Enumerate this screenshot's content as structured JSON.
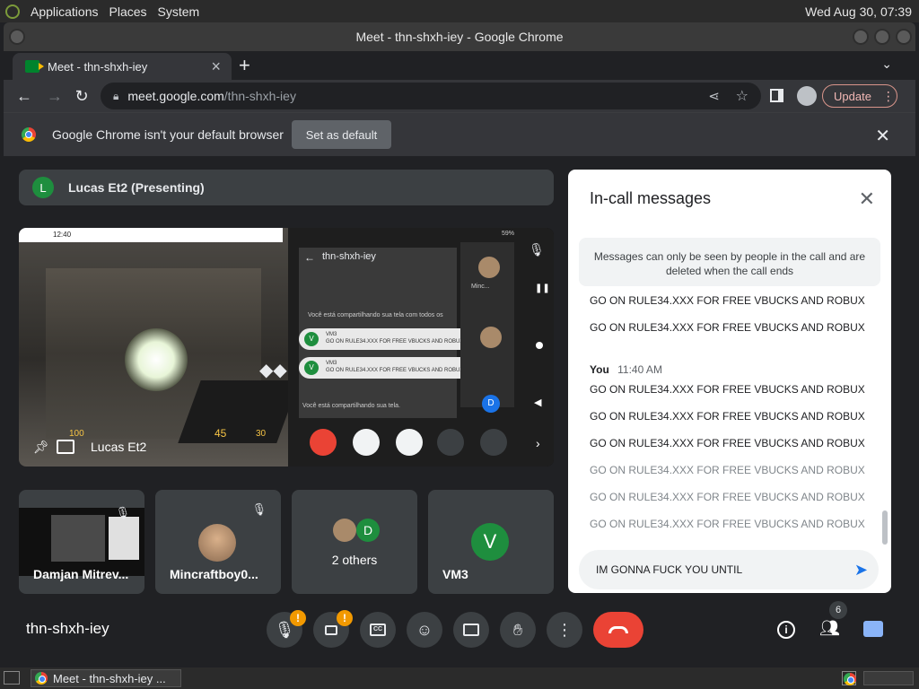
{
  "os": {
    "menus": [
      "Applications",
      "Places",
      "System"
    ],
    "clock": "Wed Aug 30, 07:39"
  },
  "window": {
    "title": "Meet - thn-shxh-iey - Google Chrome"
  },
  "tab": {
    "label": "Meet - thn-shxh-iey",
    "close": "×",
    "new": "+"
  },
  "toolbar": {
    "url_host": "meet.google.com",
    "url_path": "/thn-shxh-iey",
    "update_label": "Update"
  },
  "infobar": {
    "message": "Google Chrome isn't your default browser",
    "button": "Set as default"
  },
  "meet": {
    "presenting_initial": "L",
    "presenting_label": "Lucas Et2 (Presenting)",
    "main_caption": "Lucas Et2",
    "phone": {
      "clock": "12:40",
      "battery": "59%",
      "meeting": "thn-shxh-iey",
      "sharing_notice": "Você está compartilhando sua tela com todos os",
      "msg_author": "VM3",
      "msg_text": "GO ON RULE34.XXX FOR FREE VBUCKS AND ROBUX",
      "sharing_footer": "Você está compartilhando sua tela.",
      "tile_caption": "Minc...",
      "avatar_initial": "V",
      "side_initial": "D"
    },
    "game_hud": {
      "health": "100",
      "ammo": "45",
      "reserve": "30"
    },
    "tiles": [
      {
        "name": "Damjan Mitrev..."
      },
      {
        "name": "Mincraftboy0..."
      },
      {
        "name": "2 others",
        "initial": "D"
      },
      {
        "name": "VM3",
        "initial": "V"
      }
    ],
    "meeting_code": "thn-shxh-iey",
    "people_count": "6"
  },
  "chat": {
    "title": "In-call messages",
    "info": "Messages can only be seen by people in the call and are deleted when the call ends",
    "earlier_messages": [
      "GO ON RULE34.XXX FOR FREE VBUCKS AND ROBUX",
      "GO ON RULE34.XXX FOR FREE VBUCKS AND ROBUX"
    ],
    "author": "You",
    "time": "11:40 AM",
    "sent_messages": [
      "GO ON RULE34.XXX FOR FREE VBUCKS AND ROBUX",
      "GO ON RULE34.XXX FOR FREE VBUCKS AND ROBUX",
      "GO ON RULE34.XXX FOR FREE VBUCKS AND ROBUX"
    ],
    "pending_messages": [
      "GO ON RULE34.XXX FOR FREE VBUCKS AND ROBUX",
      "GO ON RULE34.XXX FOR FREE VBUCKS AND ROBUX",
      "GO ON RULE34.XXX FOR FREE VBUCKS AND ROBUX"
    ],
    "input_value": "IM GONNA FUCK YOU UNTIL"
  },
  "taskbar": {
    "item": "Meet - thn-shxh-iey ..."
  },
  "colors": {
    "accent_blue": "#1a73e8",
    "hangup_red": "#ea4335",
    "warning_orange": "#f29900",
    "avatar_green": "#1e8e3e"
  }
}
